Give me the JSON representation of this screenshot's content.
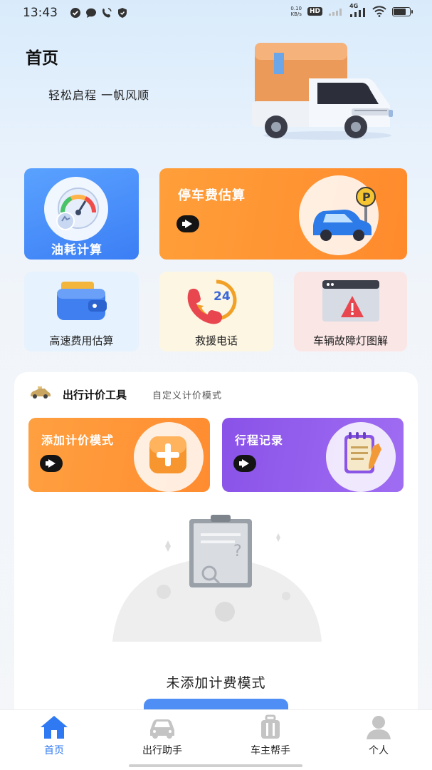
{
  "status_bar": {
    "time": "13:43",
    "net_speed_value": "0.10",
    "net_speed_unit": "KB/s",
    "hd_badge": "HD",
    "network_type": "4G",
    "left_icons": [
      "check-circle-icon",
      "chat-bubble-icon",
      "phone-wifi-icon",
      "shield-icon"
    ],
    "battery_level": 0.8
  },
  "header": {
    "title": "首页",
    "subtitle": "轻松启程 一帆风顺"
  },
  "features": {
    "fuel": {
      "label": "油耗计算",
      "icon": "gauge-icon"
    },
    "parking": {
      "label": "停车费估算",
      "icon": "parking-car-icon"
    },
    "highway": {
      "label": "高速费用估算",
      "icon": "wallet-icon"
    },
    "rescue": {
      "label": "救援电话",
      "icon": "phone-24-icon"
    },
    "fault": {
      "label": "车辆故障灯图解",
      "icon": "warning-window-icon"
    }
  },
  "tools": {
    "title": "出行计价工具",
    "subtitle": "自定义计价模式",
    "add_mode": {
      "label": "添加计价模式",
      "icon": "plus-icon"
    },
    "trip_record": {
      "label": "行程记录",
      "icon": "notepad-icon"
    }
  },
  "empty_state": {
    "text": "未添加计费模式"
  },
  "bottom_nav": {
    "items": [
      {
        "label": "首页",
        "icon": "home-icon",
        "active": true
      },
      {
        "label": "出行助手",
        "icon": "car-icon",
        "active": false
      },
      {
        "label": "车主帮手",
        "icon": "luggage-icon",
        "active": false
      },
      {
        "label": "个人",
        "icon": "person-icon",
        "active": false
      }
    ]
  },
  "colors": {
    "accent": "#2f7af3",
    "orange": "#ff9232",
    "purple": "#9060ee",
    "blue_card": "#4a90fa"
  }
}
